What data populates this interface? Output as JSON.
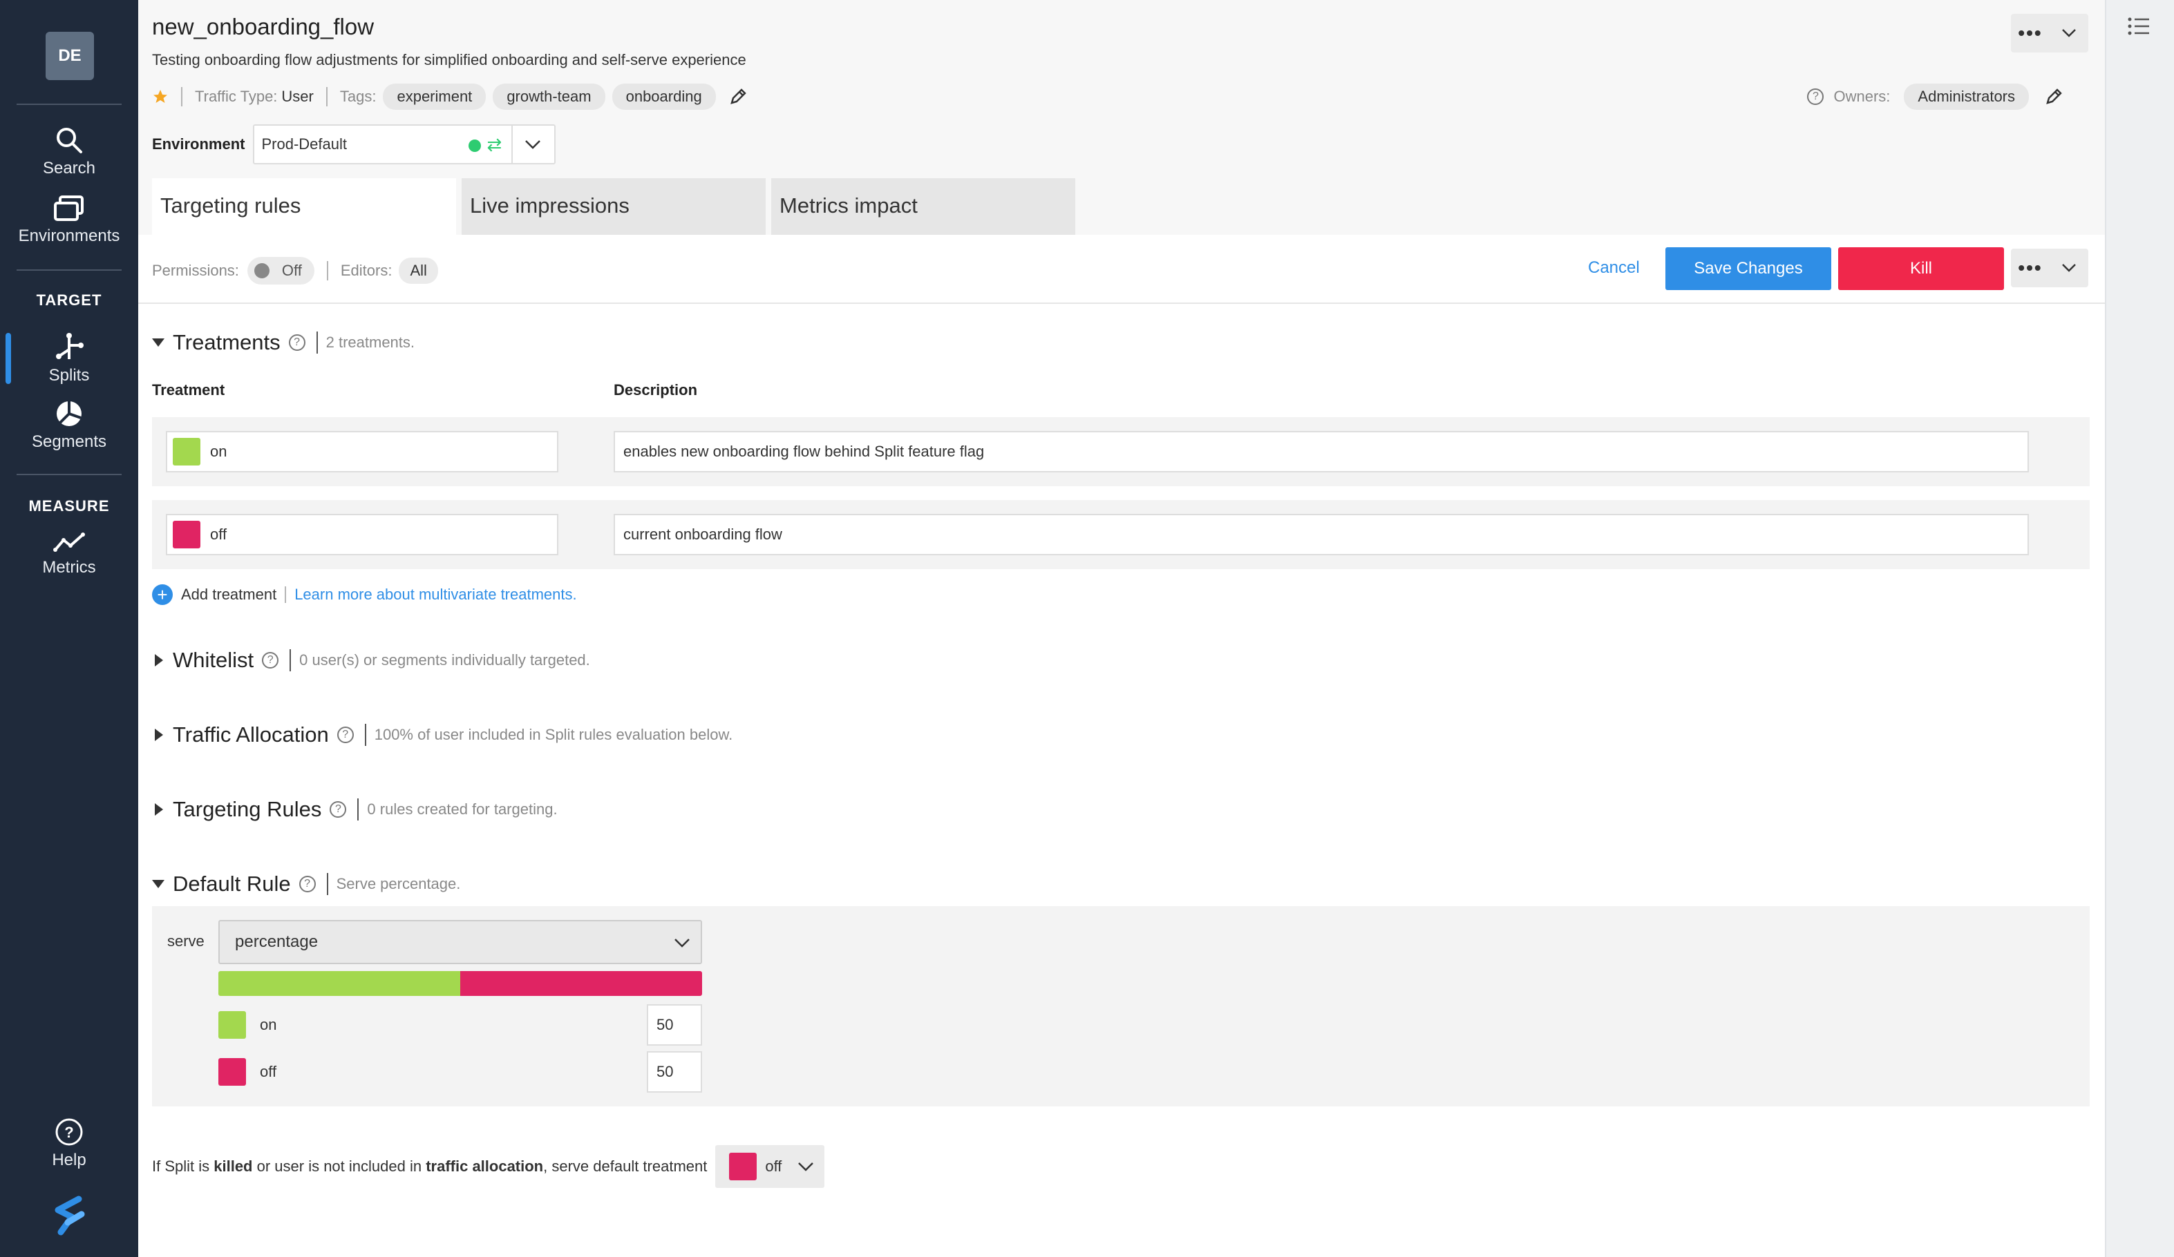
{
  "nav": {
    "avatar": "DE",
    "items": [
      {
        "label": "Search",
        "icon": "search-icon"
      },
      {
        "label": "Environments",
        "icon": "environments-icon"
      },
      {
        "label": "Splits",
        "icon": "splits-icon"
      },
      {
        "label": "Segments",
        "icon": "segments-icon"
      },
      {
        "label": "Metrics",
        "icon": "metrics-icon"
      },
      {
        "label": "Help",
        "icon": "help-icon"
      }
    ],
    "headings": {
      "target": "TARGET",
      "measure": "MEASURE"
    }
  },
  "header": {
    "title": "new_onboarding_flow",
    "subtitle": "Testing onboarding flow adjustments for simplified onboarding and self-serve experience",
    "traffic_type_label": "Traffic Type:",
    "traffic_type_value": "User",
    "tags_label": "Tags:",
    "tags": [
      "experiment",
      "growth-team",
      "onboarding"
    ],
    "owners_label": "Owners:",
    "owners": "Administrators",
    "environment_label": "Environment",
    "environment_value": "Prod-Default",
    "more": "•••"
  },
  "tabs": [
    {
      "label": "Targeting rules",
      "active": true
    },
    {
      "label": "Live impressions",
      "active": false
    },
    {
      "label": "Metrics impact",
      "active": false
    }
  ],
  "toolbar": {
    "permissions_label": "Permissions:",
    "permissions_value": "Off",
    "editors_label": "Editors:",
    "editors_value": "All",
    "cancel": "Cancel",
    "save": "Save Changes",
    "kill": "Kill",
    "more": "•••"
  },
  "treatments": {
    "title": "Treatments",
    "note": "2 treatments.",
    "col_treatment": "Treatment",
    "col_description": "Description",
    "rows": [
      {
        "name": "on",
        "description": "enables new onboarding flow behind Split feature flag",
        "color": "#a3d84e"
      },
      {
        "name": "off",
        "description": "current onboarding flow",
        "color": "#e02463"
      }
    ],
    "add": "Add treatment",
    "learn_more": "Learn more about multivariate treatments."
  },
  "sections": {
    "whitelist": {
      "title": "Whitelist",
      "note": "0 user(s) or segments individually targeted."
    },
    "traffic": {
      "title": "Traffic Allocation",
      "note": "100% of user included in Split rules evaluation below."
    },
    "targeting": {
      "title": "Targeting Rules",
      "note": "0 rules created for targeting."
    },
    "default": {
      "title": "Default Rule",
      "note": "Serve percentage."
    }
  },
  "default_rule": {
    "serve_label": "serve",
    "serve_value": "percentage",
    "split": [
      {
        "name": "on",
        "percent": "50",
        "color": "#a3d84e"
      },
      {
        "name": "off",
        "percent": "50",
        "color": "#e02463"
      }
    ]
  },
  "footer": {
    "t1": "If Split is ",
    "b1": "killed",
    "t2": " or user is not included in ",
    "b2": "traffic allocation",
    "t3": ", serve default treatment",
    "default_value": "off",
    "default_color": "#e02463"
  },
  "colors": {
    "accent": "#2f8ee6",
    "kill": "#f0274b",
    "nav": "#1f2a3b",
    "star": "#f5a623",
    "env_status": "#2ecc71"
  }
}
